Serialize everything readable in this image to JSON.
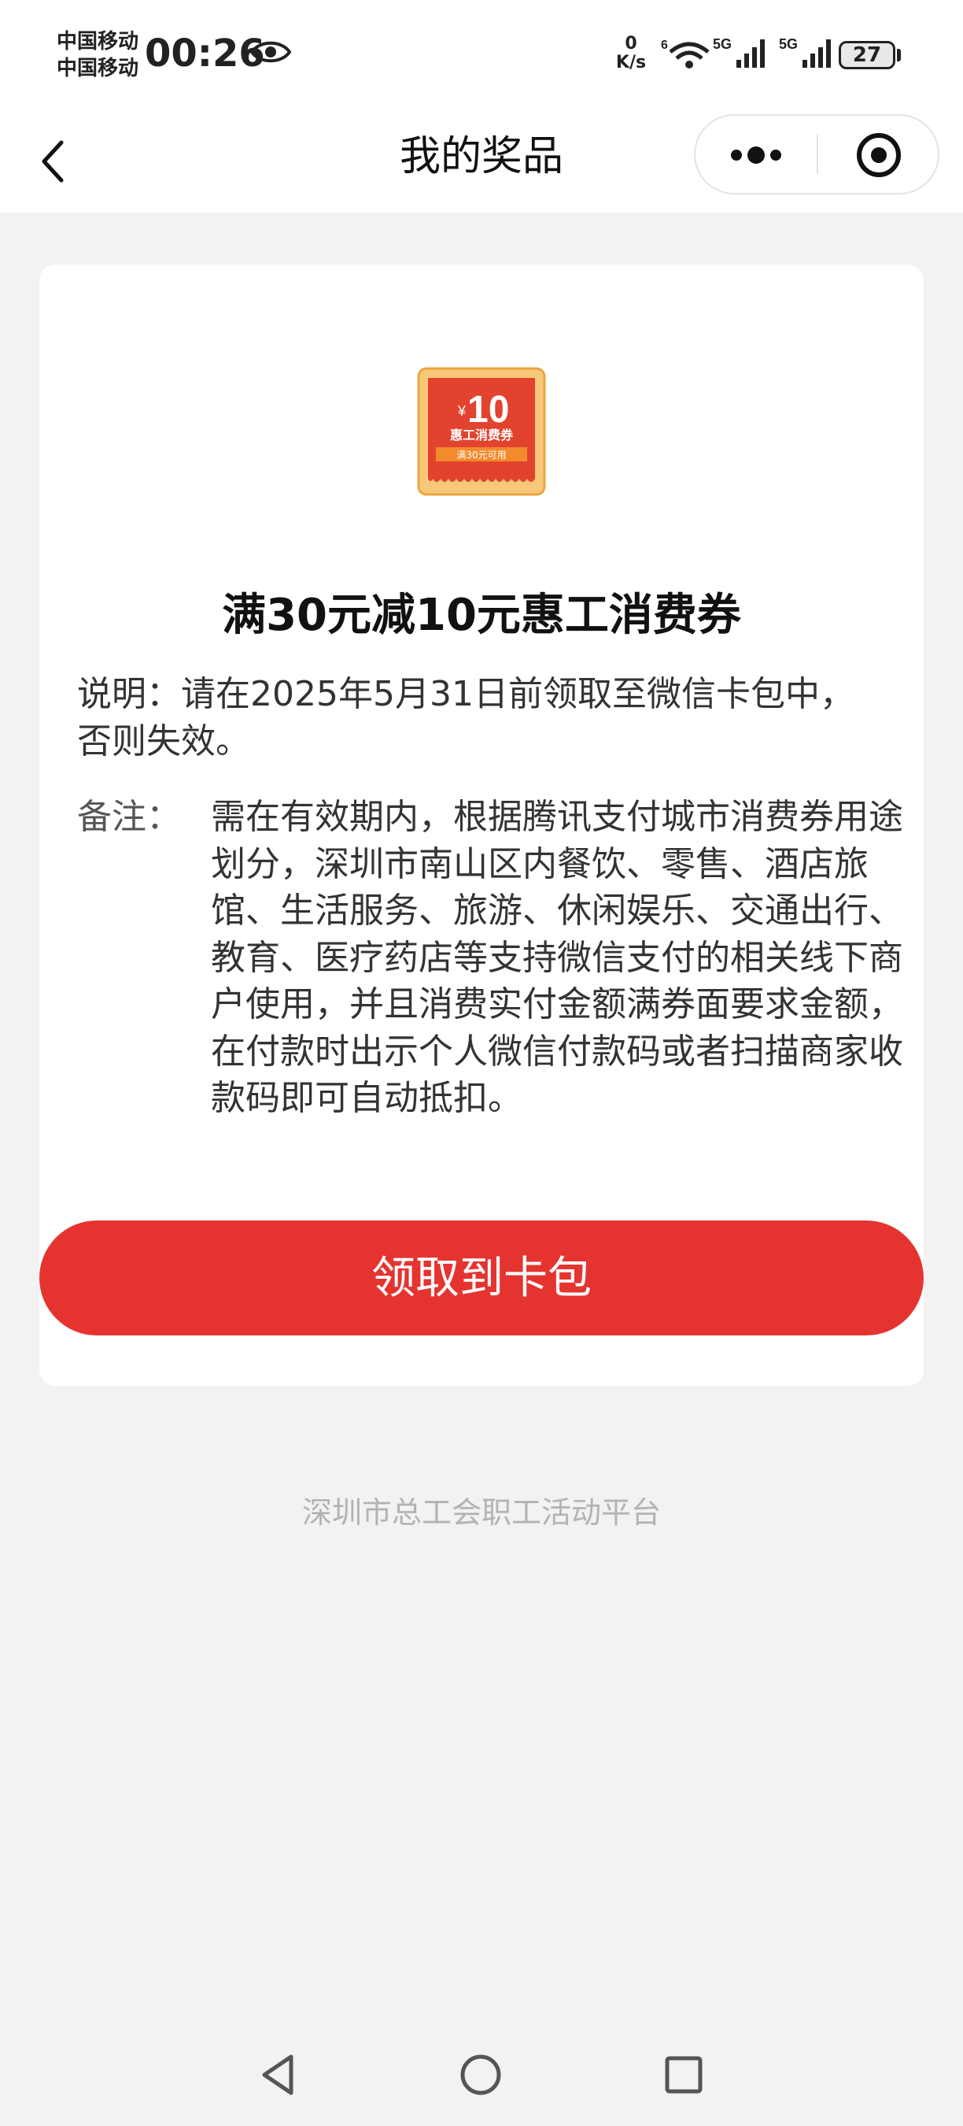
{
  "status_bar": {
    "carrier_1": "中国移动",
    "carrier_2": "中国移动",
    "time": "00:26",
    "net_speed_value": "0",
    "net_speed_unit": "K/s",
    "wifi_badge": "6",
    "sim1_label": "5G",
    "sim2_label": "5G",
    "battery": "27"
  },
  "nav": {
    "title": "我的奖品",
    "icons": [
      "back-chevron-icon",
      "more-dots-icon",
      "close-target-icon"
    ]
  },
  "prize": {
    "coupon_image": {
      "currency": "¥",
      "amount": "10",
      "name": "惠工消费券",
      "condition": "满30元可用"
    },
    "title": "满30元减10元惠工消费券",
    "description": "说明：请在2025年5月31日前领取至微信卡包中，否则失效。",
    "remark_label": "备注：",
    "remark_text": "需在有效期内，根据腾讯支付城市消费券用途划分，深圳市南山区内餐饮、零售、酒店旅馆、生活服务、旅游、休闲娱乐、交通出行、教育、医疗药店等支持微信支付的相关线下商户使用，并且消费实付金额满券面要求金额，在付款时出示个人微信付款码或者扫描商家收款码即可自动抵扣。",
    "claim_button": "领取到卡包"
  },
  "footer": {
    "text": "深圳市总工会职工活动平台"
  },
  "colors": {
    "accent_red": "#e53430",
    "background": "#f2f2f2",
    "card": "#ffffff",
    "footer_text": "#b3b3b3"
  }
}
